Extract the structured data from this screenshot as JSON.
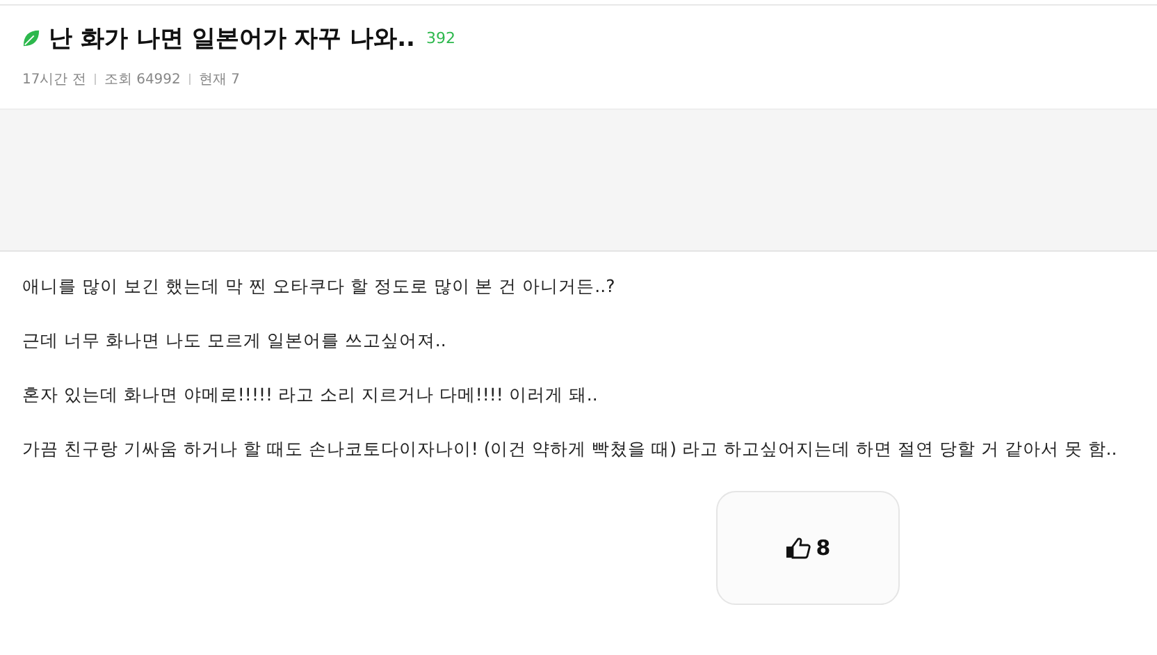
{
  "post": {
    "title": "난 화가 나면 일본어가 자꾸 나와..",
    "comment_count": "392",
    "meta": [
      "17시간 전",
      "조회 64992",
      "현재 7"
    ],
    "paragraphs": [
      "애니를 많이 보긴 했는데 막 찐 오타쿠다 할 정도로 많이 본 건 아니거든..?",
      "근데 너무 화나면 나도 모르게 일본어를 쓰고싶어져..",
      "혼자 있는데 화나면 야메로!!!!! 라고 소리 지르거나 다메!!!! 이러게 돼..",
      "가끔 친구랑 기싸움 하거나 할 때도 손나코토다이자나이! (이건 약하게 빡쳤을 때) 라고 하고싶어지는데 하면 절연 당할 거 같아서 못 함.."
    ],
    "like_count": "8"
  }
}
